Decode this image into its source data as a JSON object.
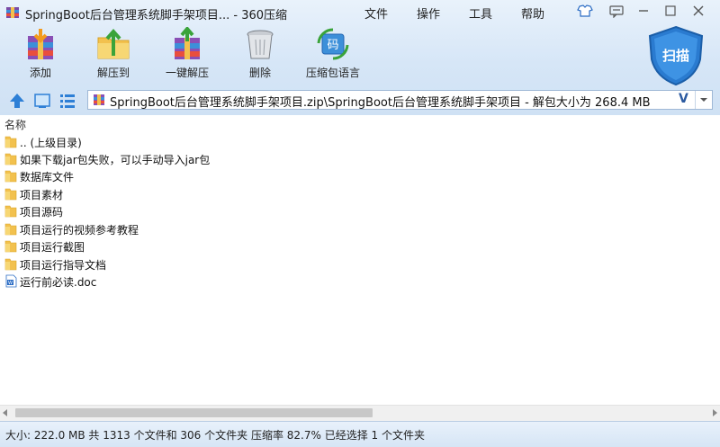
{
  "window": {
    "title": "SpringBoot后台管理系统脚手架项目... - 360压缩",
    "menu": [
      "文件",
      "操作",
      "工具",
      "帮助"
    ]
  },
  "toolbar": {
    "add_label": "添加",
    "extract_to_label": "解压到",
    "one_click_extract_label": "一键解压",
    "delete_label": "删除",
    "archive_language_label": "压缩包语言",
    "scan_label": "扫描",
    "language_icon_char": "码"
  },
  "path": {
    "text": "SpringBoot后台管理系统脚手架项目.zip\\SpringBoot后台管理系统脚手架项目 - 解包大小为 268.4 MB",
    "v_glyph": "V"
  },
  "list": {
    "column_name": "名称",
    "items": [
      {
        "name": ".. (上级目录)",
        "type": "folder"
      },
      {
        "name": "如果下载jar包失败，可以手动导入jar包",
        "type": "folder"
      },
      {
        "name": "数据库文件",
        "type": "folder"
      },
      {
        "name": "项目素材",
        "type": "folder"
      },
      {
        "name": "项目源码",
        "type": "folder"
      },
      {
        "name": "项目运行的视频参考教程",
        "type": "folder"
      },
      {
        "name": "项目运行截图",
        "type": "folder"
      },
      {
        "name": "项目运行指导文档",
        "type": "folder"
      },
      {
        "name": "运行前必读.doc",
        "type": "doc"
      }
    ]
  },
  "status": {
    "text": "大小: 222.0 MB 共 1313 个文件和 306 个文件夹 压缩率 82.7% 已经选择 1 个文件夹"
  },
  "colors": {
    "accent": "#2b6cc4",
    "folder": "#f2c14e",
    "shield": "#2a7bd0"
  }
}
